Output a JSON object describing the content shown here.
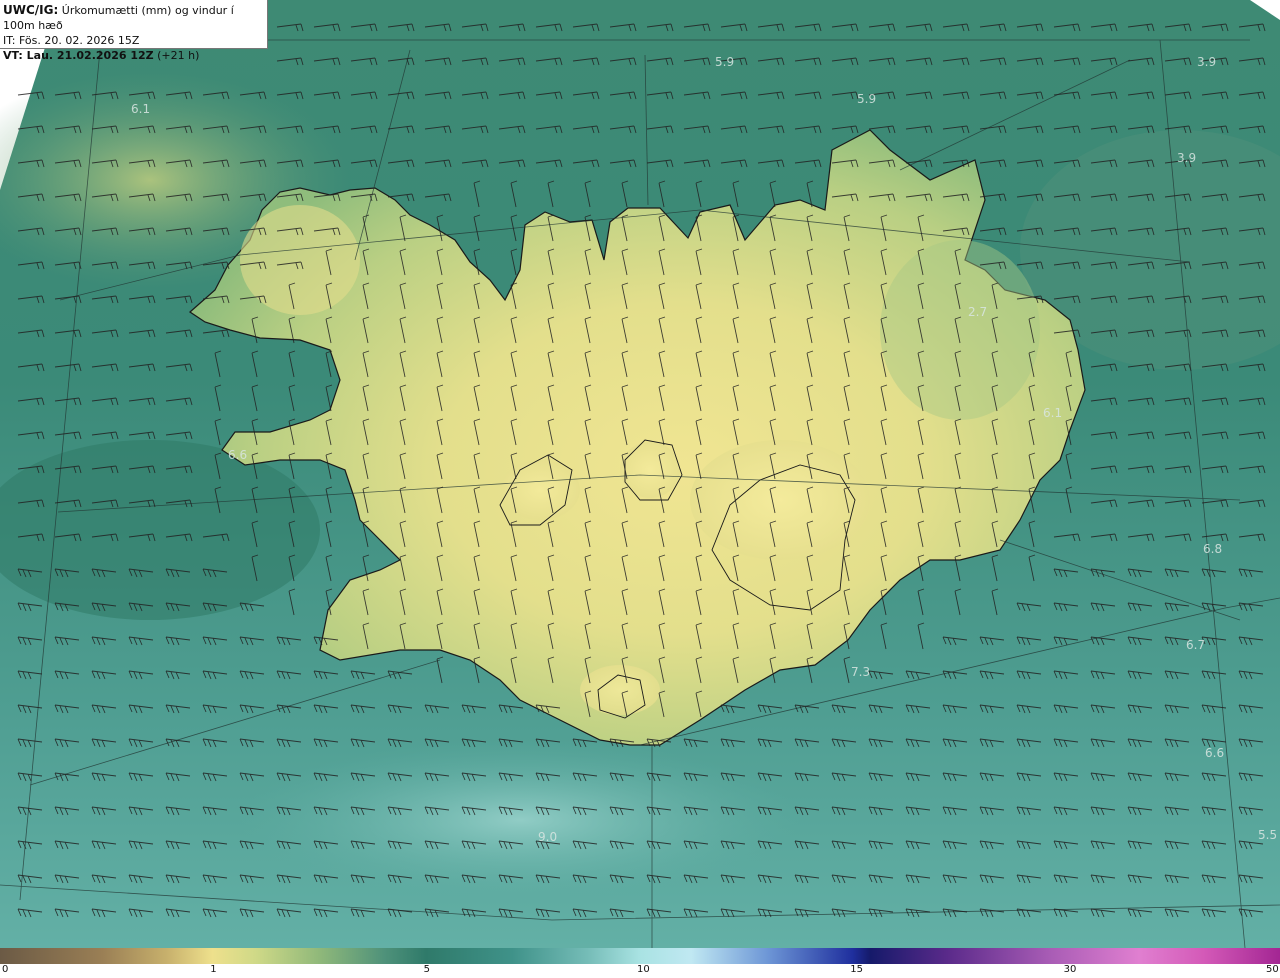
{
  "header": {
    "model": "UWC/IG:",
    "description": "Úrkomumætti (mm) og vindur í 100m hæð",
    "init_time": "IT: Fös. 20. 02. 2026 15Z",
    "valid_prefix": "VT: Lau. 21.02.2026 12Z",
    "valid_offset": "(+21 h)"
  },
  "colors": {
    "sea": "#3f8d80",
    "land": "#d9db86",
    "highland": "#eee591",
    "coast": "#1a1a1a",
    "barb": "#222222",
    "grid": "#2a3a38"
  },
  "map_labels": [
    {
      "text": "6.1"
    },
    {
      "text": "5.9"
    },
    {
      "text": "5.9"
    },
    {
      "text": "3.9"
    },
    {
      "text": "3.9"
    },
    {
      "text": "2.7"
    },
    {
      "text": "6.1"
    },
    {
      "text": "6.8"
    },
    {
      "text": "6.7"
    },
    {
      "text": "7.3"
    },
    {
      "text": "6.6"
    },
    {
      "text": "5.5"
    },
    {
      "text": "9.0"
    },
    {
      "text": "6.6"
    }
  ],
  "colorbar": {
    "min": 0,
    "max": 50,
    "ticks": [
      {
        "label": "0",
        "value": 0
      },
      {
        "label": "1",
        "value": 1
      },
      {
        "label": "5",
        "value": 5
      },
      {
        "label": "10",
        "value": 10
      },
      {
        "label": "15",
        "value": 15
      },
      {
        "label": "30",
        "value": 30
      },
      {
        "label": "50",
        "value": 50
      }
    ]
  }
}
